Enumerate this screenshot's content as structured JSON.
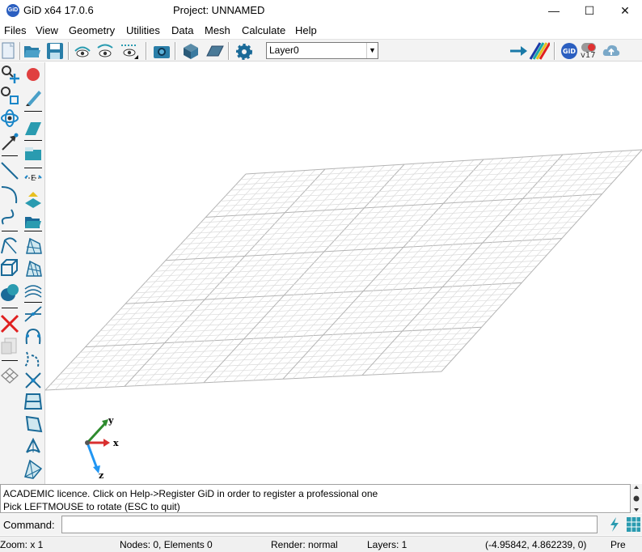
{
  "window": {
    "app_icon_text": "GiD",
    "title": "GiD x64 17.0.6",
    "project": "Project: UNNAMED",
    "minimize": "—",
    "maximize": "☐",
    "close": "✕"
  },
  "menu": [
    "Files",
    "View",
    "Geometry",
    "Utilities",
    "Data",
    "Mesh",
    "Calculate",
    "Help"
  ],
  "toolbar": {
    "layer_value": "Layer0",
    "version_badge": "v17",
    "gid_badge": "GiD",
    "icons": [
      "new-file-icon",
      "open-folder-icon",
      "save-icon",
      "rotate-view-icon",
      "rotate-object-icon",
      "rotate-center-icon",
      "screenshot-camera-icon",
      "layers-3d-icon",
      "surface-plane-icon",
      "preferences-gear-icon",
      "preprocess-arrow-icon",
      "rainbow-postprocess-icon",
      "gid-logo-icon",
      "toggle-version-icon",
      "cloud-upload-icon"
    ]
  },
  "left_toolbar": {
    "col1": [
      "zoom-in-icon",
      "zoom-frame-icon",
      "rotate-trackball-icon",
      "point-icon",
      "line-icon",
      "arc-icon",
      "nurbs-line-icon",
      "surface-icon",
      "volume-icon",
      "object-icon",
      "delete-icon",
      "copy-icon",
      "mesh-icon"
    ],
    "col2": [
      "record-icon",
      "edit-icon",
      "plane-surface-icon",
      "nurbs-surface-icon",
      "edit-point-icon",
      "layer-to-use-icon",
      "folder-open-icon",
      "coons-surface-icon",
      "surface-mesh-icon",
      "parallel-lines-icon",
      "intersect-lines-icon",
      "divide-curve-icon",
      "polyline-icon",
      "intersect-x-icon",
      "hexahedra-icon",
      "cylinder-icon",
      "cone-icon",
      "sphere-icon"
    ]
  },
  "axes": {
    "x": "x",
    "y": "y",
    "z": "z"
  },
  "messages": {
    "line1": "ACADEMIC licence. Click on Help->Register GiD in order to register a professional one",
    "line2": "Pick LEFTMOUSE to rotate (ESC to quit)"
  },
  "command": {
    "label": "Command:",
    "value": ""
  },
  "status": {
    "zoom": "Zoom: x 1",
    "nodes": "Nodes: 0, Elements 0",
    "render": "Render: normal",
    "layers": "Layers: 1",
    "coords": "(-4.95842, 4.862239, 0)",
    "mode": "Pre"
  },
  "colors": {
    "accent": "#1a86c8",
    "teal": "#2a9bb0",
    "grid_line": "#c8c8c8",
    "axis_x": "#d93030",
    "axis_y": "#2e8b2e",
    "axis_z": "#2196f3"
  }
}
